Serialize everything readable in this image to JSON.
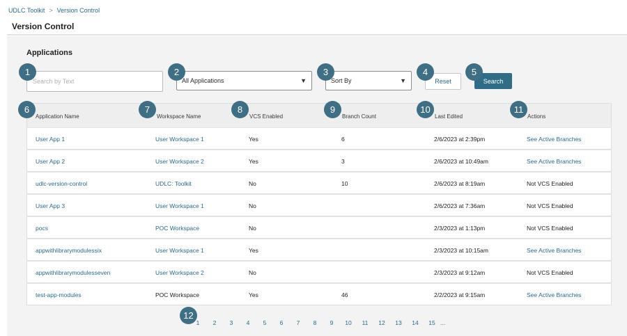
{
  "breadcrumb": {
    "root": "UDLC Toolkit",
    "separator": ">",
    "current": "Version Control"
  },
  "page_title": "Version Control",
  "section_title": "Applications",
  "search": {
    "placeholder": "Search by Text",
    "value": ""
  },
  "filters": {
    "applications": {
      "selected": "All Applications"
    },
    "sort": {
      "selected": "Sort By"
    },
    "reset_label": "Reset",
    "search_label": "Search"
  },
  "columns": [
    "Application Name",
    "Workspace Name",
    "VCS Enabled",
    "Branch Count",
    "Last Edited",
    "Actions"
  ],
  "rows": [
    {
      "app": "User App 1",
      "workspace": "User Workspace 1",
      "workspace_link": true,
      "vcs": "Yes",
      "branches": "6",
      "edited": "2/6/2023 at 2:39pm",
      "action": "See Active Branches",
      "action_link": true
    },
    {
      "app": "User App 2",
      "workspace": "User Workspace 2",
      "workspace_link": true,
      "vcs": "Yes",
      "branches": "3",
      "edited": "2/6/2023 at 10:49am",
      "action": "See Active Branches",
      "action_link": true
    },
    {
      "app": "udlc-version-control",
      "workspace": "UDLC: Toolkit",
      "workspace_link": true,
      "vcs": "No",
      "branches": "10",
      "edited": "2/6/2023 at 8:19am",
      "action": "Not VCS Enabled",
      "action_link": false
    },
    {
      "app": "User App 3",
      "workspace": "User Workspace 1",
      "workspace_link": true,
      "vcs": "No",
      "branches": "",
      "edited": "2/6/2023 at 7:36am",
      "action": "Not VCS Enabled",
      "action_link": false
    },
    {
      "app": "pocs",
      "workspace": "POC Workspace",
      "workspace_link": true,
      "vcs": "No",
      "branches": "",
      "edited": "2/3/2023 at 1:13pm",
      "action": "Not VCS Enabled",
      "action_link": false
    },
    {
      "app": "appwithlibrarymodulessix",
      "workspace": "User Workspace 1",
      "workspace_link": true,
      "vcs": "Yes",
      "branches": "",
      "edited": "2/3/2023 at 10:15am",
      "action": "See Active Branches",
      "action_link": true
    },
    {
      "app": "appwithlibrarymodulesseven",
      "workspace": "User Workspace 2",
      "workspace_link": true,
      "vcs": "No",
      "branches": "",
      "edited": "2/3/2023 at 9:12am",
      "action": "Not VCS Enabled",
      "action_link": false
    },
    {
      "app": "test-app-modules",
      "workspace": "POC Workspace",
      "workspace_link": false,
      "vcs": "Yes",
      "branches": "46",
      "edited": "2/2/2023 at 9:15am",
      "action": "See Active Branches",
      "action_link": true
    }
  ],
  "pagination": {
    "pages": [
      "1",
      "2",
      "3",
      "4",
      "5",
      "6",
      "7",
      "8",
      "9",
      "10",
      "11",
      "12",
      "13",
      "14",
      "15"
    ],
    "more": "..."
  },
  "badges": [
    "1",
    "2",
    "3",
    "4",
    "5",
    "6",
    "7",
    "8",
    "9",
    "10",
    "11",
    "12"
  ],
  "colors": {
    "accent": "#2f6c86",
    "link": "#2a6a88",
    "badge": "#3e6f85",
    "panel": "#f3f3f3"
  }
}
